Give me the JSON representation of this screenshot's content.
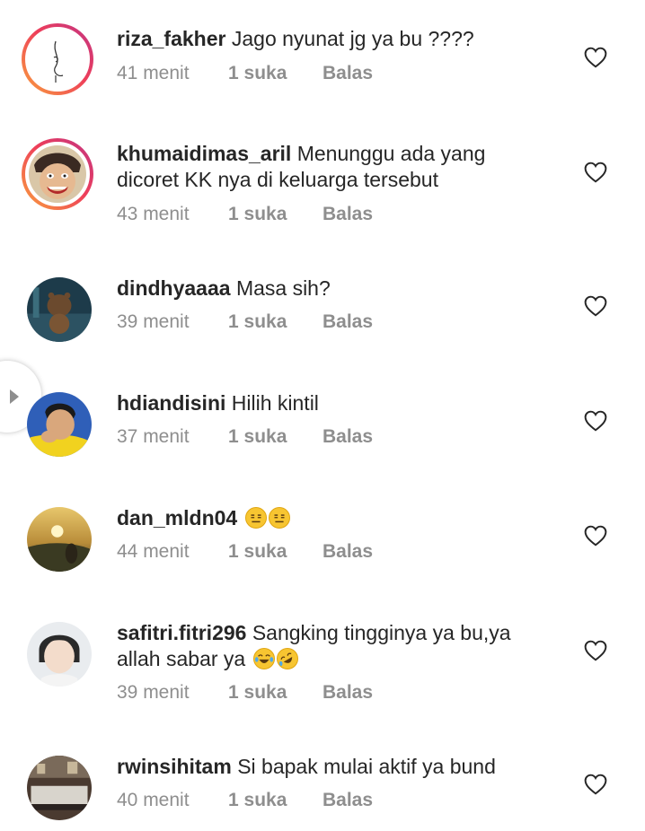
{
  "comments": [
    {
      "username": "riza_fakher",
      "text": "Jago nyunat jg ya bu ????",
      "time": "41 menit",
      "likes": "1 suka",
      "reply": "Balas",
      "avatar": "riza-fakher-avatar"
    },
    {
      "username": "khumaidimas_aril",
      "text": "Menunggu ada yang dicoret KK nya di keluarga tersebut",
      "time": "43 menit",
      "likes": "1 suka",
      "reply": "Balas",
      "avatar": "khumaidimas-aril-avatar"
    },
    {
      "username": "dindhyaaaa",
      "text": "Masa sih?",
      "time": "39 menit",
      "likes": "1 suka",
      "reply": "Balas",
      "avatar": "dindhyaaaa-avatar"
    },
    {
      "username": "hdiandisini",
      "text": "Hilih kintil",
      "time": "37 menit",
      "likes": "1 suka",
      "reply": "Balas",
      "avatar": "hdiandisini-avatar"
    },
    {
      "username": "dan_mldn04",
      "text": "",
      "time": "44 menit",
      "likes": "1 suka",
      "reply": "Balas",
      "avatar": "dan-mldn04-avatar",
      "emojis": [
        "expressionless-face-emoji",
        "expressionless-face-emoji"
      ]
    },
    {
      "username": "safitri.fitri296",
      "text": "Sangking tingginya ya bu,ya allah sabar ya",
      "time": "39 menit",
      "likes": "1 suka",
      "reply": "Balas",
      "avatar": "safitri-fitri296-avatar",
      "emojis": [
        "tears-of-joy-emoji",
        "rolling-laughing-emoji"
      ]
    },
    {
      "username": "rwinsihitam",
      "text": "Si bapak mulai aktif ya bund",
      "time": "40 menit",
      "likes": "1 suka",
      "reply": "Balas",
      "avatar": "rwinsihitam-avatar"
    }
  ],
  "icons": {
    "like": "heart-outline-icon",
    "side_tab": "play-arrow-icon"
  },
  "colors": {
    "text": "#262626",
    "meta": "#8e8e8e",
    "story_ring_start": "#f9a23c",
    "story_ring_end": "#c13584"
  }
}
